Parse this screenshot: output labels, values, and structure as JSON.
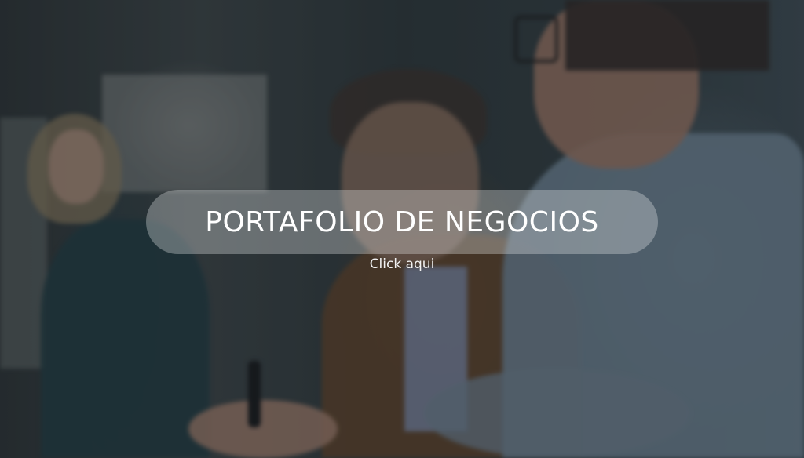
{
  "banner": {
    "title": "PORTAFOLIO DE NEGOCIOS",
    "link_label": "Click aqui",
    "background_image": "business-meeting-photo"
  },
  "colors": {
    "overlay": "#192024",
    "pill": "#ebeef0",
    "text": "#ffffff"
  }
}
